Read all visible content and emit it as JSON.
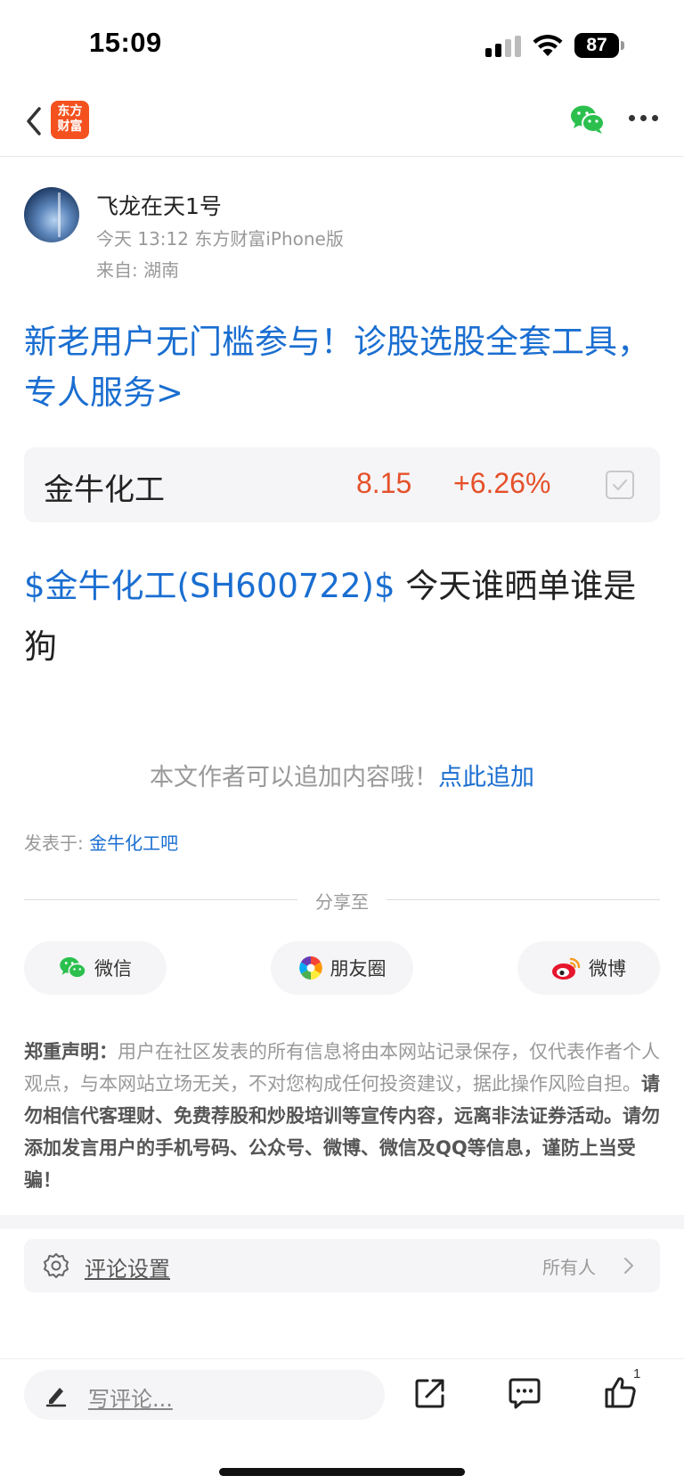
{
  "status_bar": {
    "time": "15:09",
    "battery": "87"
  },
  "nav": {
    "logo_text_line1": "东方",
    "logo_text_line2": "财富"
  },
  "author": {
    "name": "飞龙在天1号",
    "meta": "今天 13:12 东方财富iPhone版",
    "location": "来自: 湖南"
  },
  "promo": {
    "text": "新老用户无门槛参与！诊股选股全套工具，专人服务>"
  },
  "stock": {
    "name": "金牛化工",
    "price": "8.15",
    "change": "+6.26%"
  },
  "post": {
    "stock_link": "$金牛化工(SH600722)$",
    "text": " 今天谁晒单谁是狗"
  },
  "append": {
    "text": "本文作者可以追加内容哦！",
    "link": "点此追加"
  },
  "posted_in": {
    "label": "发表于: ",
    "link": "金牛化工吧"
  },
  "share": {
    "title": "分享至",
    "buttons": [
      {
        "label": "微信",
        "icon": "wechat-icon"
      },
      {
        "label": "朋友圈",
        "icon": "moments-icon"
      },
      {
        "label": "微博",
        "icon": "weibo-icon"
      }
    ]
  },
  "disclaimer": {
    "label": "郑重声明：",
    "text": "用户在社区发表的所有信息将由本网站记录保存，仅代表作者个人观点，与本网站立场无关，不对您构成任何投资建议，据此操作风险自担。",
    "bold": "请勿相信代客理财、免费荐股和炒股培训等宣传内容，远离非法证券活动。请勿添加发言用户的手机号码、公众号、微博、微信及QQ等信息，谨防上当受骗！"
  },
  "comment_settings": {
    "label": "评论设置",
    "value": "所有人"
  },
  "bottom_bar": {
    "placeholder": "写评论...",
    "like_count": "1"
  },
  "colors": {
    "link_blue": "#1a6ed1",
    "stock_red": "#e5512a",
    "brand_orange": "#f4511e",
    "wechat_green": "#2bc04e"
  }
}
